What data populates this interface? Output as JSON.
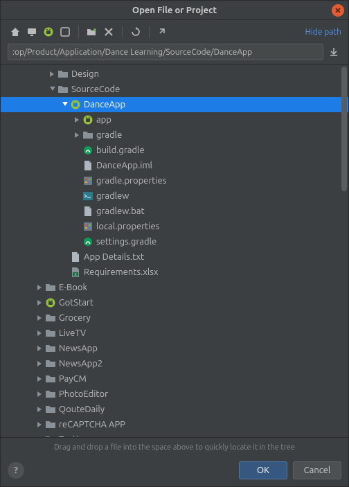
{
  "titlebar": {
    "title": "Open File or Project"
  },
  "toolbar": {
    "hide_path": "Hide path"
  },
  "path": {
    "value": ":op/Product/Application/Dance Learning/SourceCode/DanceApp"
  },
  "tree": {
    "rows": [
      {
        "indent": 3,
        "arrow": "right",
        "icon": "folder",
        "label": "Design"
      },
      {
        "indent": 3,
        "arrow": "down",
        "icon": "folder",
        "label": "SourceCode"
      },
      {
        "indent": 4,
        "arrow": "down",
        "icon": "android",
        "label": "DanceApp",
        "selected": true
      },
      {
        "indent": 5,
        "arrow": "right",
        "icon": "android",
        "label": "app"
      },
      {
        "indent": 5,
        "arrow": "right",
        "icon": "folder",
        "label": "gradle"
      },
      {
        "indent": 5,
        "arrow": "none",
        "icon": "gradle",
        "label": "build.gradle"
      },
      {
        "indent": 5,
        "arrow": "none",
        "icon": "file",
        "label": "DanceApp.iml"
      },
      {
        "indent": 5,
        "arrow": "none",
        "icon": "props",
        "label": "gradle.properties"
      },
      {
        "indent": 5,
        "arrow": "none",
        "icon": "term",
        "label": "gradlew"
      },
      {
        "indent": 5,
        "arrow": "none",
        "icon": "file",
        "label": "gradlew.bat"
      },
      {
        "indent": 5,
        "arrow": "none",
        "icon": "props",
        "label": "local.properties"
      },
      {
        "indent": 5,
        "arrow": "none",
        "icon": "gradle",
        "label": "settings.gradle"
      },
      {
        "indent": 4,
        "arrow": "none",
        "icon": "file",
        "label": "App Details.txt"
      },
      {
        "indent": 4,
        "arrow": "none",
        "icon": "xlsx",
        "label": "Requirements.xlsx"
      },
      {
        "indent": 2,
        "arrow": "right",
        "icon": "folder",
        "label": "E-Book"
      },
      {
        "indent": 2,
        "arrow": "right",
        "icon": "android",
        "label": "GotStart"
      },
      {
        "indent": 2,
        "arrow": "right",
        "icon": "folder",
        "label": "Grocery"
      },
      {
        "indent": 2,
        "arrow": "right",
        "icon": "folder",
        "label": "LiveTV"
      },
      {
        "indent": 2,
        "arrow": "right",
        "icon": "folder",
        "label": "NewsApp"
      },
      {
        "indent": 2,
        "arrow": "right",
        "icon": "folder",
        "label": "NewsApp2"
      },
      {
        "indent": 2,
        "arrow": "right",
        "icon": "folder",
        "label": "PayCM"
      },
      {
        "indent": 2,
        "arrow": "right",
        "icon": "folder",
        "label": "PhotoEditor"
      },
      {
        "indent": 2,
        "arrow": "right",
        "icon": "folder",
        "label": "QouteDaily"
      },
      {
        "indent": 2,
        "arrow": "right",
        "icon": "folder",
        "label": "reCAPTCHA APP"
      },
      {
        "indent": 2,
        "arrow": "right",
        "icon": "folder",
        "label": "TaxiApp"
      }
    ]
  },
  "hint": "Drag and drop a file into the space above to quickly locate it in the tree",
  "buttons": {
    "help": "?",
    "ok": "OK",
    "cancel": "Cancel"
  }
}
